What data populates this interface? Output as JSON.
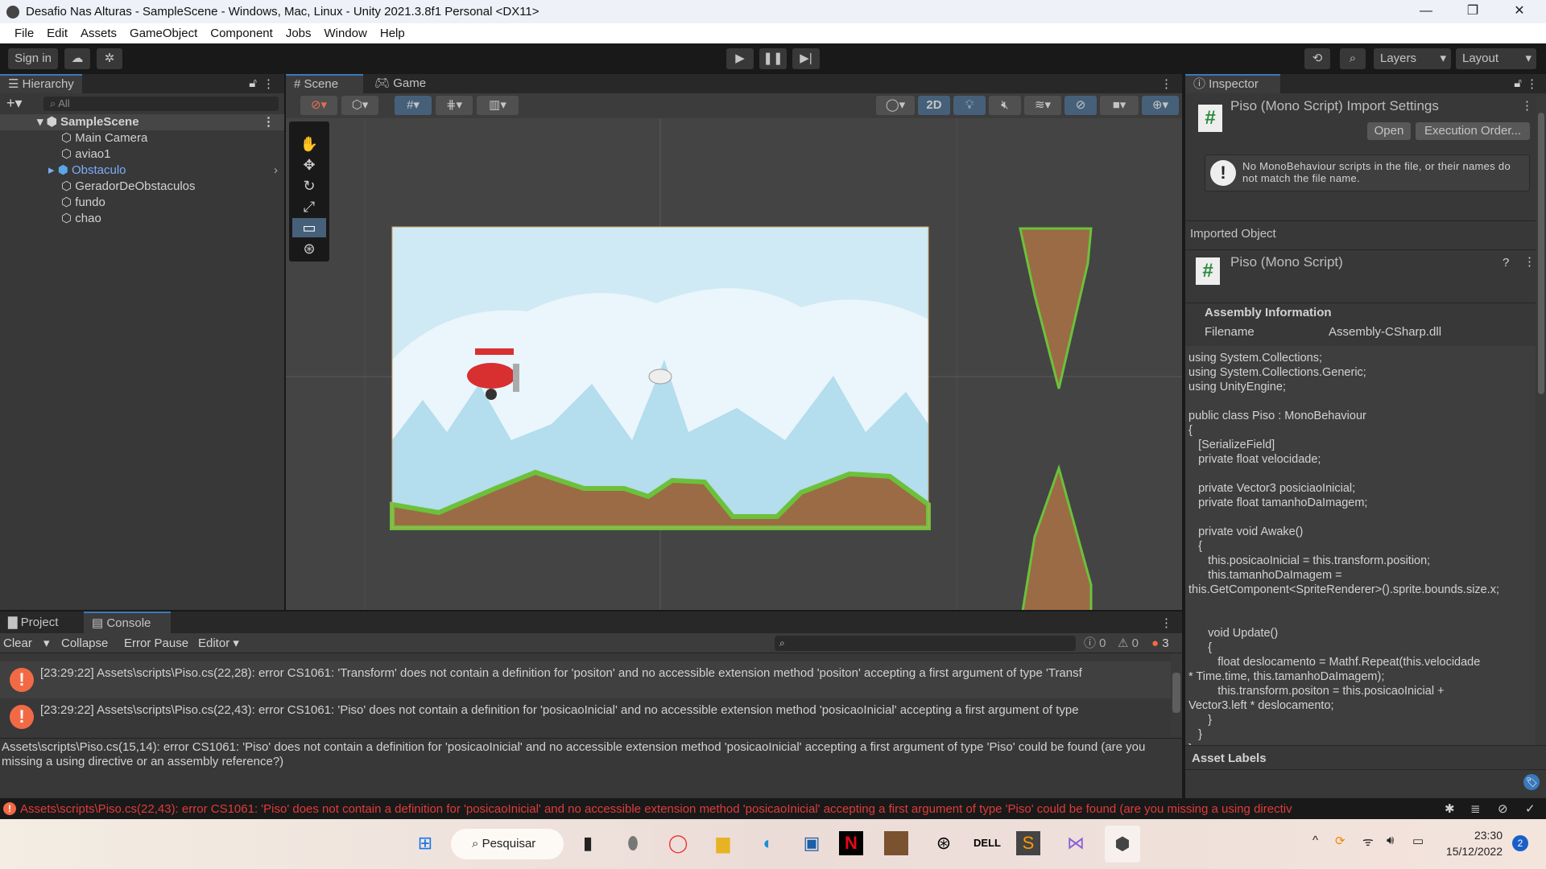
{
  "window": {
    "title": "Desafio Nas Alturas - SampleScene - Windows, Mac, Linux - Unity 2021.3.8f1 Personal <DX11>",
    "minimize": "—",
    "restore": "❐",
    "close": "✕"
  },
  "menu": [
    "File",
    "Edit",
    "Assets",
    "GameObject",
    "Component",
    "Jobs",
    "Window",
    "Help"
  ],
  "toolbar": {
    "sign_in": "Sign in",
    "layers": "Layers",
    "layout": "Layout"
  },
  "hierarchy": {
    "title": "Hierarchy",
    "search_placeholder": "All",
    "scene": "SampleScene",
    "items": [
      "Main Camera",
      "aviao1",
      "Obstaculo",
      "GeradorDeObstaculos",
      "fundo",
      "chao"
    ]
  },
  "scene_tabs": {
    "scene": "Scene",
    "game": "Game",
    "mode_2d": "2D"
  },
  "inspector": {
    "title": "Inspector",
    "header": "Piso (Mono Script) Import Settings",
    "open": "Open",
    "execution_order": "Execution Order...",
    "warning": "No MonoBehaviour scripts in the file, or their names do not match the file name.",
    "imported_object": "Imported Object",
    "object_name": "Piso (Mono Script)",
    "assembly_info": "Assembly Information",
    "filename_label": "Filename",
    "filename_value": "Assembly-CSharp.dll",
    "asset_labels": "Asset Labels",
    "code": "using System.Collections;\nusing System.Collections.Generic;\nusing UnityEngine;\n\npublic class Piso : MonoBehaviour\n{\n   [SerializeField]\n   private float velocidade;\n\n   private Vector3 posiciaoInicial;\n   private float tamanhoDaImagem;\n\n   private void Awake()\n   {\n      this.posicaoInicial = this.transform.position;\n      this.tamanhoDaImagem =\nthis.GetComponent<SpriteRenderer>().sprite.bounds.size.x;\n\n\n      void Update()\n      {\n         float deslocamento = Mathf.Repeat(this.velocidade\n* Time.time, this.tamanhoDaImagem);\n         this.transform.positon = this.posicaoInicial +\nVector3.left * deslocamento;\n      }\n   }\n}"
  },
  "console": {
    "project_tab": "Project",
    "console_tab": "Console",
    "clear": "Clear",
    "collapse": "Collapse",
    "error_pause": "Error Pause",
    "editor": "Editor",
    "log_count": "0",
    "warn_count": "0",
    "error_count": "3",
    "entries": [
      "[23:29:22] Assets\\scripts\\Piso.cs(22,28): error CS1061: 'Transform' does not contain a definition for 'positon' and no accessible extension method 'positon' accepting a first argument of type 'Transf",
      "[23:29:22] Assets\\scripts\\Piso.cs(22,43): error CS1061: 'Piso' does not contain a definition for 'posicaoInicial' and no accessible extension method 'posicaoInicial' accepting a first argument of type"
    ],
    "detail": "Assets\\scripts\\Piso.cs(15,14): error CS1061: 'Piso' does not contain a definition for 'posicaoInicial' and no accessible extension method 'posicaoInicial' accepting a first argument of type 'Piso' could be found (are you missing a using directive or an assembly reference?)"
  },
  "status_bar": {
    "message": "Assets\\scripts\\Piso.cs(22,43): error CS1061: 'Piso' does not contain a definition for 'posicaoInicial' and no accessible extension method 'posicaoInicial' accepting a first argument of type 'Piso' could be found (are you missing a using directiv",
    "error_color": "#e03b3b"
  },
  "taskbar": {
    "search": "Pesquisar",
    "time": "23:30",
    "date": "15/12/2022",
    "notifications": "2"
  },
  "colors": {
    "accent": "#3a79bb",
    "error": "#f26a45",
    "sky": "#cfeaf5",
    "ground": "#9b6b45",
    "grass": "#6cc13a"
  }
}
